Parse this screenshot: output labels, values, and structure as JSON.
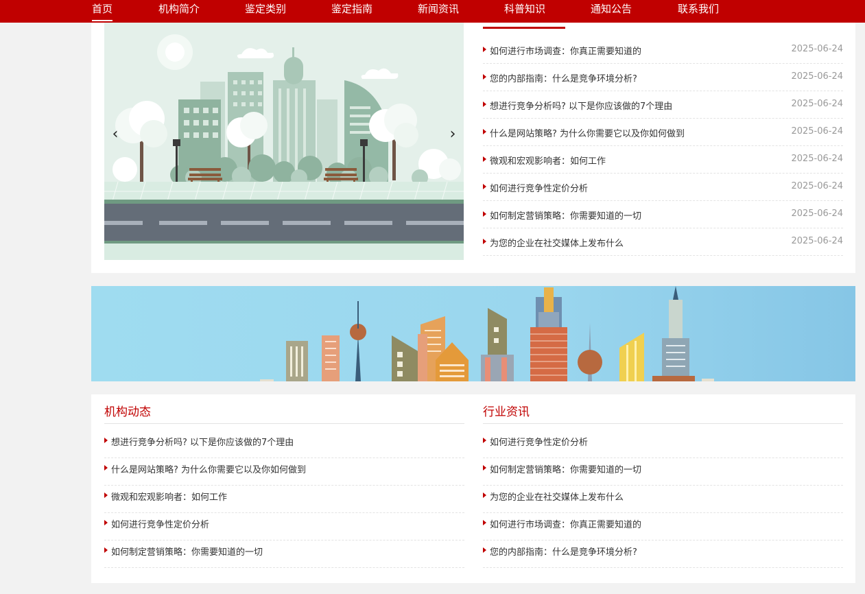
{
  "nav": {
    "items": [
      {
        "label": "首页"
      },
      {
        "label": "机构简介"
      },
      {
        "label": "鉴定类别"
      },
      {
        "label": "鉴定指南"
      },
      {
        "label": "新闻资讯"
      },
      {
        "label": "科普知识"
      },
      {
        "label": "通知公告"
      },
      {
        "label": "联系我们"
      }
    ],
    "active_index": 0
  },
  "slider": {
    "prev_icon": "chevron-left-icon",
    "next_icon": "chevron-right-icon",
    "prev_glyph": "‹",
    "next_glyph": "›"
  },
  "news": {
    "items": [
      {
        "title": "如何进行市场调查：你真正需要知道的",
        "date": "2025-06-24"
      },
      {
        "title": "您的内部指南：什么是竞争环境分析?",
        "date": "2025-06-24"
      },
      {
        "title": "想进行竞争分析吗? 以下是你应该做的7个理由",
        "date": "2025-06-24"
      },
      {
        "title": "什么是网站策略? 为什么你需要它以及你如何做到",
        "date": "2025-06-24"
      },
      {
        "title": "微观和宏观影响者：如何工作",
        "date": "2025-06-24"
      },
      {
        "title": "如何进行竞争性定价分析",
        "date": "2025-06-24"
      },
      {
        "title": "如何制定营销策略：你需要知道的一切",
        "date": "2025-06-24"
      },
      {
        "title": "为您的企业在社交媒体上发布什么",
        "date": "2025-06-24"
      }
    ]
  },
  "org_news": {
    "title": "机构动态",
    "items": [
      {
        "title": "想进行竞争分析吗? 以下是你应该做的7个理由"
      },
      {
        "title": "什么是网站策略? 为什么你需要它以及你如何做到"
      },
      {
        "title": "微观和宏观影响者：如何工作"
      },
      {
        "title": "如何进行竞争性定价分析"
      },
      {
        "title": "如何制定营销策略：你需要知道的一切"
      }
    ]
  },
  "industry_news": {
    "title": "行业资讯",
    "items": [
      {
        "title": "如何进行竞争性定价分析"
      },
      {
        "title": "如何制定营销策略：你需要知道的一切"
      },
      {
        "title": "为您的企业在社交媒体上发布什么"
      },
      {
        "title": "如何进行市场调查：你真正需要知道的"
      },
      {
        "title": "您的内部指南：什么是竞争环境分析?"
      }
    ]
  },
  "colors": {
    "brand": "#c00000",
    "page_bg": "#f2f2f2",
    "date": "#999999"
  }
}
